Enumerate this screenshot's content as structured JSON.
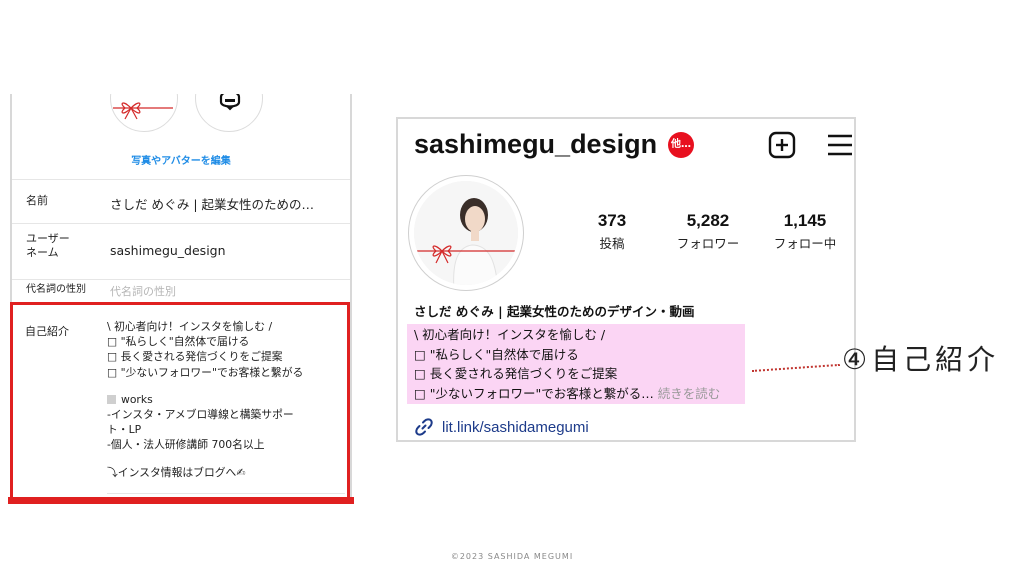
{
  "edit_screen": {
    "edit_photo_link": "写真やアバターを編集",
    "fields": {
      "name_label": "名前",
      "name_value": "さしだ めぐみ | 起業女性のための…",
      "username_label_1": "ユーザー",
      "username_label_2": "ネーム",
      "username_value": "sashimegu_design",
      "pronouns_label": "代名詞の性別",
      "pronouns_placeholder": "代名詞の性別"
    },
    "bio": {
      "label": "自己紹介",
      "lines": [
        "\\ 初心者向け！インスタを愉しむ /",
        "□ \"私らしく\"自然体で届ける",
        "□ 長く愛される発信づくりをご提案",
        "□ \"少ないフォロワー\"でお客様と繋がる",
        "works",
        "-インスタ・アメブロ導線と構築サポー",
        "ト・LP",
        "-個人・法人研修講師 700名以上",
        "⤵インスタ情報はブログへ✍"
      ]
    }
  },
  "profile": {
    "username": "sashimegu_design",
    "badge": "他…",
    "stats": [
      {
        "value": "373",
        "label": "投稿"
      },
      {
        "value": "5,282",
        "label": "フォロワー"
      },
      {
        "value": "1,145",
        "label": "フォロー中"
      }
    ],
    "display_name": "さしだ めぐみ | 起業女性のためのデザイン・動画",
    "bio_lines": [
      "\\ 初心者向け！インスタを愉しむ /",
      "□ \"私らしく\"自然体で届ける",
      "□ 長く愛される発信づくりをご提案",
      "□ \"少ないフォロワー\"でお客様と繋がる…"
    ],
    "read_more": " 続きを読む",
    "link": "lit.link/sashidamegumi"
  },
  "annotation": {
    "label": "④自己紹介"
  },
  "footer": {
    "copyright": "©2023  SASHIDA  MEGUMI"
  },
  "colors": {
    "highlight_box": "#e02020",
    "bio_highlight": "#fbd5f4",
    "link": "#1f8ce6",
    "badge": "#e8101f"
  }
}
